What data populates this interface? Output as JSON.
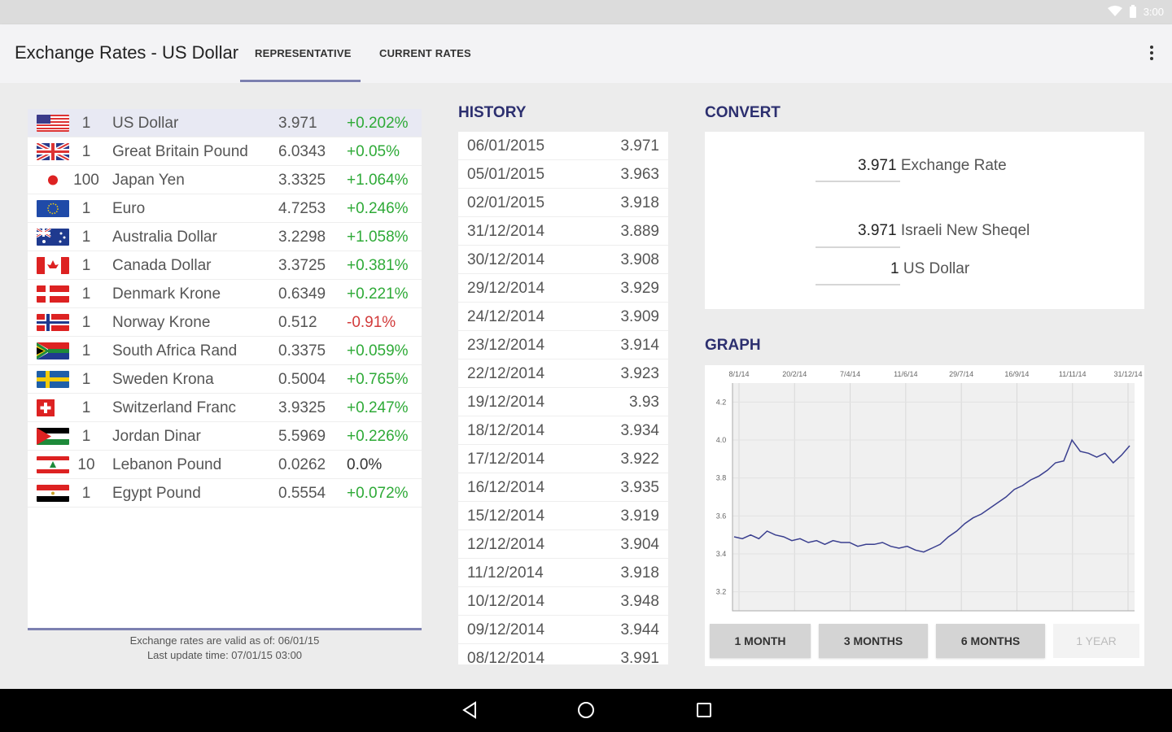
{
  "status": {
    "time": "3:00"
  },
  "appbar": {
    "title": "Exchange Rates - US Dollar",
    "tabs": [
      {
        "label": "REPRESENTATIVE",
        "active": true
      },
      {
        "label": "CURRENT RATES",
        "active": false
      }
    ]
  },
  "currencies": [
    {
      "flag": "us-flag",
      "units": "1",
      "name": "US Dollar",
      "rate": "3.971",
      "change": "+0.202%",
      "direction": "up",
      "selected": true
    },
    {
      "flag": "uk-flag",
      "units": "1",
      "name": "Great Britain Pound",
      "rate": "6.0343",
      "change": "+0.05%",
      "direction": "up"
    },
    {
      "flag": "japan-flag",
      "units": "100",
      "name": "Japan Yen",
      "rate": "3.3325",
      "change": "+1.064%",
      "direction": "up"
    },
    {
      "flag": "eu-flag",
      "units": "1",
      "name": "Euro",
      "rate": "4.7253",
      "change": "+0.246%",
      "direction": "up"
    },
    {
      "flag": "australia-flag",
      "units": "1",
      "name": "Australia Dollar",
      "rate": "3.2298",
      "change": "+1.058%",
      "direction": "up"
    },
    {
      "flag": "canada-flag",
      "units": "1",
      "name": "Canada Dollar",
      "rate": "3.3725",
      "change": "+0.381%",
      "direction": "up"
    },
    {
      "flag": "denmark-flag",
      "units": "1",
      "name": "Denmark Krone",
      "rate": "0.6349",
      "change": "+0.221%",
      "direction": "up"
    },
    {
      "flag": "norway-flag",
      "units": "1",
      "name": "Norway Krone",
      "rate": "0.512",
      "change": "-0.91%",
      "direction": "down"
    },
    {
      "flag": "south-africa-flag",
      "units": "1",
      "name": "South Africa Rand",
      "rate": "0.3375",
      "change": "+0.059%",
      "direction": "up"
    },
    {
      "flag": "sweden-flag",
      "units": "1",
      "name": "Sweden Krona",
      "rate": "0.5004",
      "change": "+0.765%",
      "direction": "up"
    },
    {
      "flag": "switzerland-flag",
      "units": "1",
      "name": "Switzerland Franc",
      "rate": "3.9325",
      "change": "+0.247%",
      "direction": "up"
    },
    {
      "flag": "jordan-flag",
      "units": "1",
      "name": "Jordan Dinar",
      "rate": "5.5969",
      "change": "+0.226%",
      "direction": "up"
    },
    {
      "flag": "lebanon-flag",
      "units": "10",
      "name": "Lebanon Pound",
      "rate": "0.0262",
      "change": "0.0%",
      "direction": "neutral"
    },
    {
      "flag": "egypt-flag",
      "units": "1",
      "name": "Egypt Pound",
      "rate": "0.5554",
      "change": "+0.072%",
      "direction": "up"
    }
  ],
  "footer": {
    "valid_line": "Exchange rates are valid as of: 06/01/15",
    "update_line": "Last update time: 07/01/15 03:00"
  },
  "history": {
    "title": "HISTORY",
    "rows": [
      {
        "date": "06/01/2015",
        "value": "3.971"
      },
      {
        "date": "05/01/2015",
        "value": "3.963"
      },
      {
        "date": "02/01/2015",
        "value": "3.918"
      },
      {
        "date": "31/12/2014",
        "value": "3.889"
      },
      {
        "date": "30/12/2014",
        "value": "3.908"
      },
      {
        "date": "29/12/2014",
        "value": "3.929"
      },
      {
        "date": "24/12/2014",
        "value": "3.909"
      },
      {
        "date": "23/12/2014",
        "value": "3.914"
      },
      {
        "date": "22/12/2014",
        "value": "3.923"
      },
      {
        "date": "19/12/2014",
        "value": "3.93"
      },
      {
        "date": "18/12/2014",
        "value": "3.934"
      },
      {
        "date": "17/12/2014",
        "value": "3.922"
      },
      {
        "date": "16/12/2014",
        "value": "3.935"
      },
      {
        "date": "15/12/2014",
        "value": "3.919"
      },
      {
        "date": "12/12/2014",
        "value": "3.904"
      },
      {
        "date": "11/12/2014",
        "value": "3.918"
      },
      {
        "date": "10/12/2014",
        "value": "3.948"
      },
      {
        "date": "09/12/2014",
        "value": "3.944"
      },
      {
        "date": "08/12/2014",
        "value": "3.991"
      }
    ]
  },
  "convert": {
    "title": "CONVERT",
    "rate_value": "3.971",
    "rate_label": "Exchange Rate",
    "ils_value": "3.971",
    "ils_label": "Israeli New Sheqel",
    "usd_value": "1",
    "usd_label": "US Dollar"
  },
  "graph": {
    "title": "GRAPH",
    "buttons": [
      {
        "label": "1 MONTH",
        "enabled": true
      },
      {
        "label": "3 MONTHS",
        "enabled": true
      },
      {
        "label": "6 MONTHS",
        "enabled": true
      },
      {
        "label": "1 YEAR",
        "enabled": false
      }
    ]
  },
  "chart_data": {
    "type": "line",
    "x_tick_labels": [
      "8/1/14",
      "20/2/14",
      "7/4/14",
      "11/6/14",
      "29/7/14",
      "16/9/14",
      "11/11/14",
      "31/12/14"
    ],
    "y_tick_labels": [
      "4.2",
      "4.0",
      "3.8",
      "3.6",
      "3.4",
      "3.2"
    ],
    "ylim": [
      3.1,
      4.3
    ],
    "grid": true,
    "line_color": "#3a3f8f",
    "series": [
      {
        "values": [
          3.49,
          3.48,
          3.5,
          3.48,
          3.52,
          3.5,
          3.49,
          3.47,
          3.48,
          3.46,
          3.47,
          3.45,
          3.47,
          3.46,
          3.46,
          3.44,
          3.45,
          3.45,
          3.46,
          3.44,
          3.43,
          3.44,
          3.42,
          3.41,
          3.43,
          3.45,
          3.49,
          3.52,
          3.56,
          3.59,
          3.61,
          3.64,
          3.67,
          3.7,
          3.74,
          3.76,
          3.79,
          3.81,
          3.84,
          3.88,
          3.89,
          4.0,
          3.94,
          3.93,
          3.91,
          3.93,
          3.88,
          3.92,
          3.97
        ]
      }
    ]
  }
}
